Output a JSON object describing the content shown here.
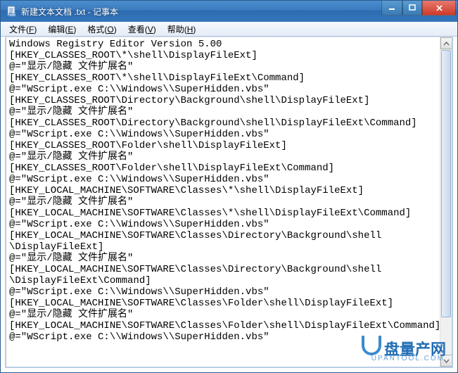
{
  "title": "新建文本文档 .txt - 记事本",
  "menus": {
    "file": "文件(F)",
    "edit": "编辑(E)",
    "format": "格式(O)",
    "view": "查看(V)",
    "help": "帮助(H)"
  },
  "content": "Windows Registry Editor Version 5.00\n[HKEY_CLASSES_ROOT\\*\\shell\\DisplayFileExt]\n@=\"显示/隐藏 文件扩展名\"\n[HKEY_CLASSES_ROOT\\*\\shell\\DisplayFileExt\\Command]\n@=\"WScript.exe C:\\\\Windows\\\\SuperHidden.vbs\"\n[HKEY_CLASSES_ROOT\\Directory\\Background\\shell\\DisplayFileExt]\n@=\"显示/隐藏 文件扩展名\"\n[HKEY_CLASSES_ROOT\\Directory\\Background\\shell\\DisplayFileExt\\Command]\n@=\"WScript.exe C:\\\\Windows\\\\SuperHidden.vbs\"\n[HKEY_CLASSES_ROOT\\Folder\\shell\\DisplayFileExt]\n@=\"显示/隐藏 文件扩展名\"\n[HKEY_CLASSES_ROOT\\Folder\\shell\\DisplayFileExt\\Command]\n@=\"WScript.exe C:\\\\Windows\\\\SuperHidden.vbs\"\n[HKEY_LOCAL_MACHINE\\SOFTWARE\\Classes\\*\\shell\\DisplayFileExt]\n@=\"显示/隐藏 文件扩展名\"\n[HKEY_LOCAL_MACHINE\\SOFTWARE\\Classes\\*\\shell\\DisplayFileExt\\Command]\n@=\"WScript.exe C:\\\\Windows\\\\SuperHidden.vbs\"\n[HKEY_LOCAL_MACHINE\\SOFTWARE\\Classes\\Directory\\Background\\shell\n\\DisplayFileExt]\n@=\"显示/隐藏 文件扩展名\"\n[HKEY_LOCAL_MACHINE\\SOFTWARE\\Classes\\Directory\\Background\\shell\n\\DisplayFileExt\\Command]\n@=\"WScript.exe C:\\\\Windows\\\\SuperHidden.vbs\"\n[HKEY_LOCAL_MACHINE\\SOFTWARE\\Classes\\Folder\\shell\\DisplayFileExt]\n@=\"显示/隐藏 文件扩展名\"\n[HKEY_LOCAL_MACHINE\\SOFTWARE\\Classes\\Folder\\shell\\DisplayFileExt\\Command]\n@=\"WScript.exe C:\\\\Windows\\\\SuperHidden.vbs\"",
  "watermark": {
    "text": "盘量产网",
    "sub": "UPANTOOL.COM"
  }
}
